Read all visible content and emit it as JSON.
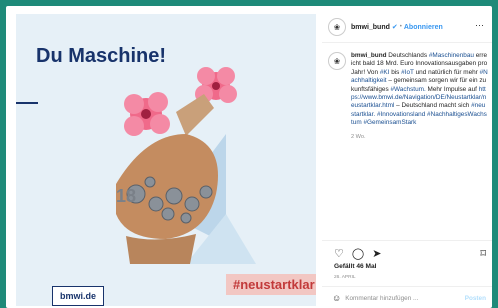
{
  "image": {
    "headline": "Du Maschine!",
    "hashtag": "#neustartklar",
    "brand": "bmwi.de"
  },
  "post": {
    "username": "bmwi_bund",
    "verified_icon": "verified-badge-icon",
    "follow_label": "Abonnieren",
    "caption_user": "bmwi_bund",
    "caption_text": "Deutschlands #Maschinenbau erreicht bald 18 Mrd. Euro Innovationsausgaben pro Jahr! Von #KI bis #IoT und natürlich für mehr #Nachhaltigkeit – gemeinsam sorgen wir für ein zukunftsfähiges #Wachstum. Mehr Impulse auf https://www.bmwi.de/Navigation/DE/Neustartklar/neustartklar.html – Deutschland macht sich #neustartklar. #Innovationsland #NachhaltigesWachstum #GemeinsamStark",
    "time": "2 Wo.",
    "likes": "Gefällt 46 Mal",
    "date": "26. APRIL",
    "comment_placeholder": "Kommentar hinzufügen ...",
    "post_label": "Posten"
  },
  "colors": {
    "background": "#1e8a79",
    "navy": "#18336b",
    "link": "#3897f0"
  }
}
